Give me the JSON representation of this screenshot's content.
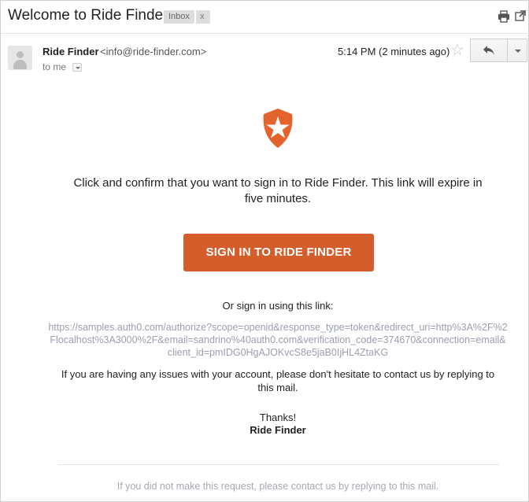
{
  "email": {
    "subject": "Welcome to Ride Finder",
    "labels": [
      {
        "name": "Inbox",
        "remove": "x"
      }
    ],
    "sender_name": "Ride Finder",
    "sender_email": "<info@ride-finder.com>",
    "to": "to me",
    "time": "5:14 PM (2 minutes ago)"
  },
  "body": {
    "intro_line1": "Click and confirm that you want to sign in to Ride Finder. This link will expire in",
    "intro_line2": "five minutes.",
    "cta_label": "SIGN IN TO RIDE FINDER",
    "or_text": "Or sign in using this link:",
    "link_lines": [
      "https://samples.auth0.com/authorize?scope=openid&response_type=token&redirect_uri=http%3A%2F%2",
      "Flocalhost%3A3000%2F&email=sandrino%40auth0.com&verification_code=374670&connection=email&",
      "client_id=pmIDG0HgAJOKvcS8e5jaB0IjHL4ZtaKG"
    ],
    "issues_line1": "If you are having any issues with your account, please don't hesitate to contact us by replying to",
    "issues_line2": "this mail.",
    "thanks": "Thanks!",
    "signature": "Ride Finder",
    "footer": "If you did not make this request, please contact us by replying to this mail."
  },
  "colors": {
    "accent": "#d35e2c",
    "link": "#9aa0ad",
    "logo": "#e4632d"
  },
  "icons": [
    "printer-icon",
    "popout-icon",
    "avatar",
    "star-icon",
    "reply-icon",
    "chevron-down-icon",
    "shield-star-logo"
  ]
}
